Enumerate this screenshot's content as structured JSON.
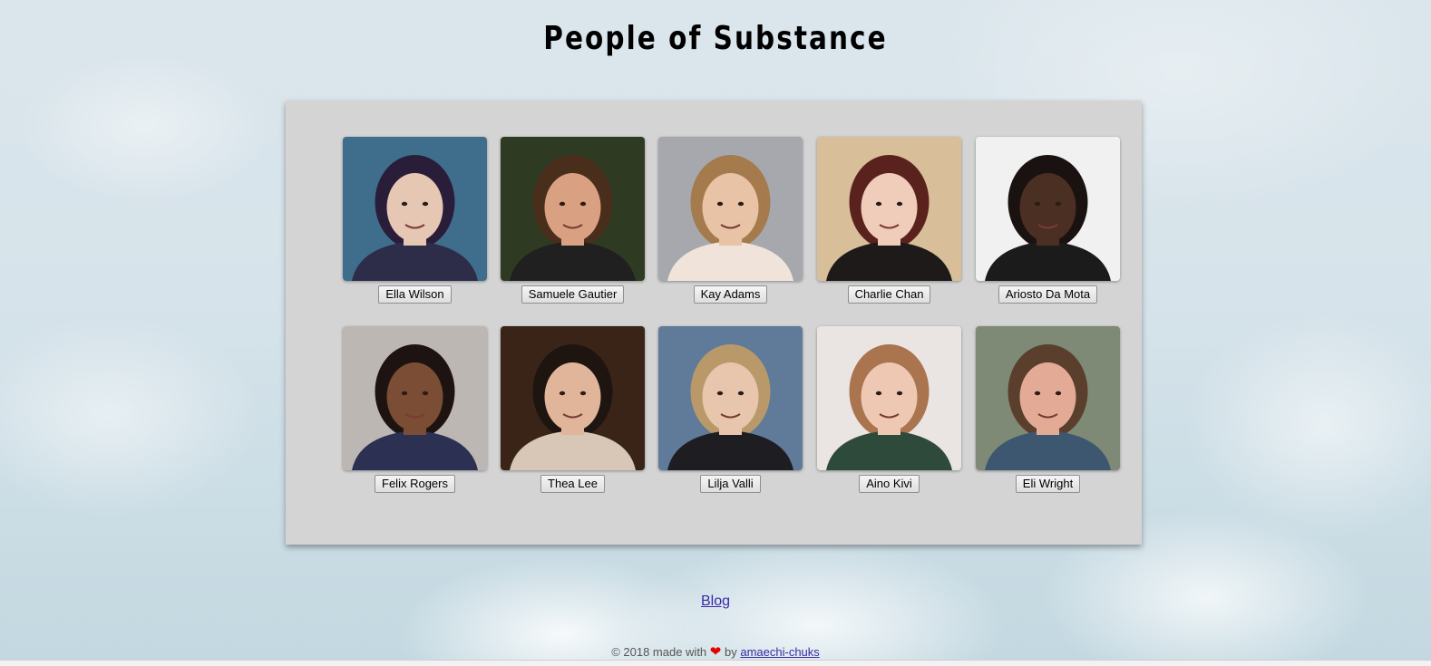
{
  "header": {
    "title": "People of Substance"
  },
  "gallery": {
    "people": [
      {
        "name": "Ella Wilson",
        "bg": "#3f6e8c",
        "skin": "#e5c7b4",
        "hair": "#2a1d3a",
        "shirt": "#2d2d4a"
      },
      {
        "name": "Samuele Gautier",
        "bg": "#2f3a22",
        "skin": "#d9a182",
        "hair": "#4a2e1c",
        "shirt": "#202020"
      },
      {
        "name": "Kay Adams",
        "bg": "#a6a8ad",
        "skin": "#e8c3a6",
        "hair": "#a57a4c",
        "shirt": "#f0e4da"
      },
      {
        "name": "Charlie Chan",
        "bg": "#d8bf9a",
        "skin": "#f0cdbb",
        "hair": "#5a221c",
        "shirt": "#1e1a1a"
      },
      {
        "name": "Ariosto Da Mota",
        "bg": "#f1f1f1",
        "skin": "#4a2f22",
        "hair": "#1a1210",
        "shirt": "#1b1b1b"
      },
      {
        "name": "Felix Rogers",
        "bg": "#bdb7b3",
        "skin": "#7a4d34",
        "hair": "#1d1411",
        "shirt": "#2c3154"
      },
      {
        "name": "Thea Lee",
        "bg": "#3a2418",
        "skin": "#e1b59a",
        "hair": "#1e1410",
        "shirt": "#d8c7b6"
      },
      {
        "name": "Lilja Valli",
        "bg": "#5f7b99",
        "skin": "#e8c6ad",
        "hair": "#b9996a",
        "shirt": "#1d1d22"
      },
      {
        "name": "Aino Kivi",
        "bg": "#eae4e2",
        "skin": "#efc8b4",
        "hair": "#a9744e",
        "shirt": "#2e4a3a"
      },
      {
        "name": "Eli Wright",
        "bg": "#7e8a75",
        "skin": "#e3ab96",
        "hair": "#5a3f2c",
        "shirt": "#3d5770"
      }
    ]
  },
  "links": {
    "blog": "Blog"
  },
  "footer": {
    "prefix": "© 2018 made with",
    "heart": "❤",
    "by": "by",
    "author": "amaechi-chuks"
  }
}
